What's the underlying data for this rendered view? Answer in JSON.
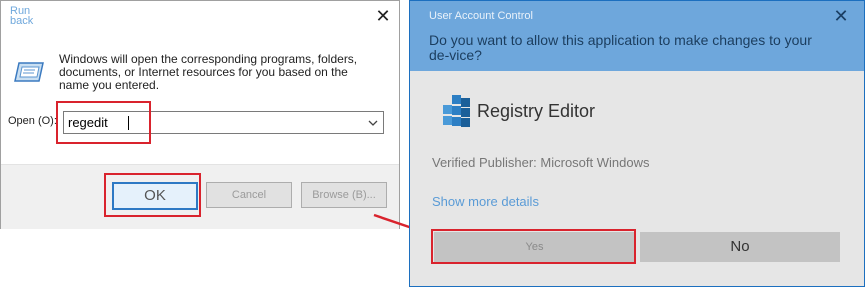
{
  "run_dialog": {
    "title": "Run back",
    "close_glyph": "✕",
    "description": "Windows will open the corresponding programs, folders, documents, or Internet resources for you based on the name you entered.",
    "open_label": "Open (O):",
    "open_value": "regedit",
    "buttons": {
      "ok": "OK",
      "cancel": "Cancel",
      "browse": "Browse (B)..."
    },
    "icons": {
      "app": "run-icon",
      "dropdown": "chevron-down-icon",
      "close": "close-icon"
    }
  },
  "uac_dialog": {
    "title": "User Account Control",
    "close_glyph": "✕",
    "question": "Do you want to allow this application to make changes to your de-vice?",
    "app_name": "Registry Editor",
    "publisher": "Verified Publisher: Microsoft Windows",
    "more_details": "Show more details",
    "buttons": {
      "yes": "Yes",
      "no": "No"
    },
    "colors": {
      "header": "#6ea7dc",
      "body": "#e6e6e6",
      "link": "#5a9bd6"
    },
    "icons": {
      "app": "registry-editor-icon",
      "close": "close-icon"
    }
  },
  "annotations": {
    "highlight_color": "#d9232d",
    "arrow_color": "#d9232d"
  }
}
